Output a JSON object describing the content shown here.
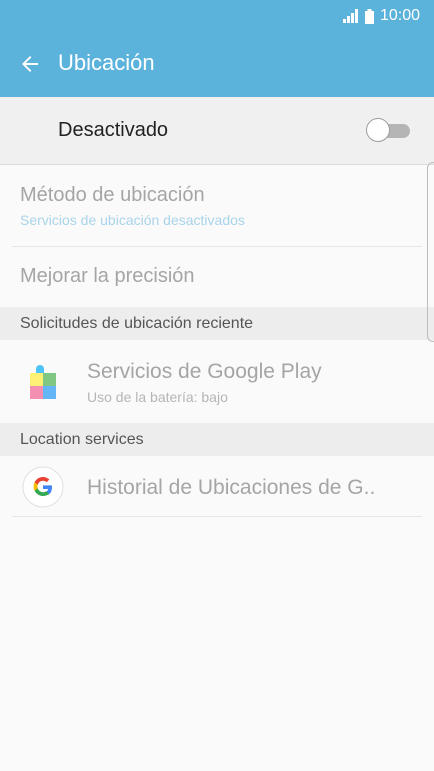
{
  "status_bar": {
    "time": "10:00",
    "signal_icon": "signal-icon",
    "battery_icon": "battery-icon"
  },
  "app_bar": {
    "title": "Ubicación",
    "back_icon": "back-arrow-icon"
  },
  "master": {
    "label": "Desactivado",
    "toggle_state": "off"
  },
  "settings": [
    {
      "title": "Método de ubicación",
      "subtitle": "Servicios de ubicación desactivados"
    },
    {
      "title": "Mejorar la precisión"
    }
  ],
  "recent_requests": {
    "header": "Solicitudes de ubicación reciente",
    "items": [
      {
        "title": "Servicios de Google Play",
        "subtitle": "Uso de la batería: bajo",
        "icon": "google-play-services-icon"
      }
    ]
  },
  "location_services": {
    "header": "Location services",
    "items": [
      {
        "title": "Historial de Ubicaciones de G..",
        "icon": "google-icon"
      }
    ]
  },
  "colors": {
    "accent": "#5bb3dc",
    "disabled_text": "#a5a5a5",
    "link_sub": "#a9d4ea"
  }
}
